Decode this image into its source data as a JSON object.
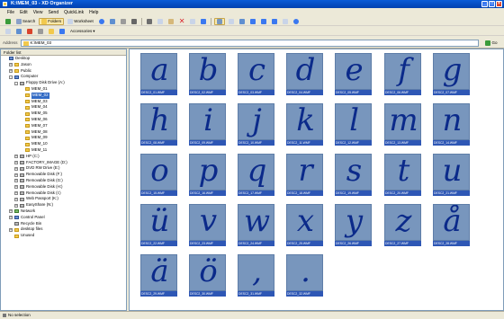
{
  "window": {
    "title": "K:\\MEM_03 - XD Organizer"
  },
  "menu": [
    "File",
    "Edit",
    "View",
    "Send",
    "QuickLink",
    "Help"
  ],
  "toolbar1": {
    "search": "Search",
    "folders": "Folders",
    "worksheet": "Worksheet"
  },
  "toolbar2": {
    "accessories": "Accessories"
  },
  "address": {
    "label": "Address",
    "value": "K:\\MEM_03",
    "go": "Go"
  },
  "tree": {
    "header": "Folder list",
    "items": [
      {
        "label": "Desktop",
        "icon": "pc",
        "indent": 0,
        "pm": ""
      },
      {
        "label": "Jason",
        "icon": "folder",
        "indent": 1,
        "pm": "+"
      },
      {
        "label": "Public",
        "icon": "folder",
        "indent": 1,
        "pm": "+"
      },
      {
        "label": "Computer",
        "icon": "pc",
        "indent": 1,
        "pm": "-"
      },
      {
        "label": "Floppy Disk Drive (A:)",
        "icon": "drive",
        "indent": 2,
        "pm": "-"
      },
      {
        "label": "MEM_01",
        "icon": "folder",
        "indent": 3,
        "pm": ""
      },
      {
        "label": "MEM_02",
        "icon": "folder",
        "indent": 3,
        "pm": "",
        "selected": true
      },
      {
        "label": "MEM_03",
        "icon": "folder",
        "indent": 3,
        "pm": ""
      },
      {
        "label": "MEM_04",
        "icon": "folder",
        "indent": 3,
        "pm": ""
      },
      {
        "label": "MEM_05",
        "icon": "folder",
        "indent": 3,
        "pm": ""
      },
      {
        "label": "MEM_06",
        "icon": "folder",
        "indent": 3,
        "pm": ""
      },
      {
        "label": "MEM_07",
        "icon": "folder",
        "indent": 3,
        "pm": ""
      },
      {
        "label": "MEM_08",
        "icon": "folder",
        "indent": 3,
        "pm": ""
      },
      {
        "label": "MEM_09",
        "icon": "folder",
        "indent": 3,
        "pm": ""
      },
      {
        "label": "MEM_10",
        "icon": "folder",
        "indent": 3,
        "pm": ""
      },
      {
        "label": "MEM_11",
        "icon": "folder",
        "indent": 3,
        "pm": ""
      },
      {
        "label": "HP (C:)",
        "icon": "drive",
        "indent": 2,
        "pm": "+"
      },
      {
        "label": "FACTORY_IMAGE (D:)",
        "icon": "drive",
        "indent": 2,
        "pm": "+"
      },
      {
        "label": "DVD RW Drive (E:)",
        "icon": "drive",
        "indent": 2,
        "pm": "+"
      },
      {
        "label": "Removable Disk (F:)",
        "icon": "drive",
        "indent": 2,
        "pm": "+"
      },
      {
        "label": "Removable Disk (G:)",
        "icon": "drive",
        "indent": 2,
        "pm": "+"
      },
      {
        "label": "Removable Disk (H:)",
        "icon": "drive",
        "indent": 2,
        "pm": "+"
      },
      {
        "label": "Removable Disk (I:)",
        "icon": "drive",
        "indent": 2,
        "pm": "+"
      },
      {
        "label": "Web Passport (K:)",
        "icon": "drive",
        "indent": 2,
        "pm": "+"
      },
      {
        "label": "EasyShare (N:)",
        "icon": "drive",
        "indent": 2,
        "pm": "+"
      },
      {
        "label": "Network",
        "icon": "net",
        "indent": 1,
        "pm": "+"
      },
      {
        "label": "Control Panel",
        "icon": "pc",
        "indent": 1,
        "pm": "+"
      },
      {
        "label": "Recycle Bin",
        "icon": "drive",
        "indent": 1,
        "pm": ""
      },
      {
        "label": "desktop files",
        "icon": "folder",
        "indent": 1,
        "pm": "+"
      },
      {
        "label": "Unused",
        "icon": "folder",
        "indent": 1,
        "pm": ""
      }
    ]
  },
  "thumbnails": [
    {
      "glyph": "a",
      "caption": "DESC2_01.WMF"
    },
    {
      "glyph": "b",
      "caption": "DESC2_02.WMF"
    },
    {
      "glyph": "c",
      "caption": "DESC2_03.WMF"
    },
    {
      "glyph": "d",
      "caption": "DESC2_04.WMF"
    },
    {
      "glyph": "e",
      "caption": "DESC2_05.WMF"
    },
    {
      "glyph": "f",
      "caption": "DESC2_06.WMF"
    },
    {
      "glyph": "g",
      "caption": "DESC2_07.WMF"
    },
    {
      "glyph": "h",
      "caption": "DESC2_08.WMF"
    },
    {
      "glyph": "i",
      "caption": "DESC2_09.WMF"
    },
    {
      "glyph": "j",
      "caption": "DESC2_10.WMF"
    },
    {
      "glyph": "k",
      "caption": "DESC2_11.WMF"
    },
    {
      "glyph": "l",
      "caption": "DESC2_12.WMF"
    },
    {
      "glyph": "m",
      "caption": "DESC2_13.WMF"
    },
    {
      "glyph": "n",
      "caption": "DESC2_14.WMF"
    },
    {
      "glyph": "o",
      "caption": "DESC2_15.WMF"
    },
    {
      "glyph": "p",
      "caption": "DESC2_16.WMF"
    },
    {
      "glyph": "q",
      "caption": "DESC2_17.WMF"
    },
    {
      "glyph": "r",
      "caption": "DESC2_18.WMF"
    },
    {
      "glyph": "s",
      "caption": "DESC2_19.WMF"
    },
    {
      "glyph": "t",
      "caption": "DESC2_20.WMF"
    },
    {
      "glyph": "u",
      "caption": "DESC2_21.WMF"
    },
    {
      "glyph": "ü",
      "caption": "DESC2_22.WMF"
    },
    {
      "glyph": "v",
      "caption": "DESC2_23.WMF"
    },
    {
      "glyph": "w",
      "caption": "DESC2_24.WMF"
    },
    {
      "glyph": "x",
      "caption": "DESC2_25.WMF"
    },
    {
      "glyph": "y",
      "caption": "DESC2_26.WMF"
    },
    {
      "glyph": "z",
      "caption": "DESC2_27.WMF"
    },
    {
      "glyph": "å",
      "caption": "DESC2_28.WMF"
    },
    {
      "glyph": "ä",
      "caption": "DESC2_29.WMF"
    },
    {
      "glyph": "ö",
      "caption": "DESC2_30.WMF"
    },
    {
      "glyph": ",",
      "caption": "DESC2_31.WMF"
    },
    {
      "glyph": ".",
      "caption": "DESC2_32.WMF"
    }
  ],
  "status": {
    "text": "No selection"
  },
  "colors": {
    "titlebar": "#0a5bd8",
    "selection": "#316ac5",
    "thumb_bg": "#7896bd",
    "caption_bg": "#2e57b5",
    "glyph": "#0b2a8a"
  }
}
